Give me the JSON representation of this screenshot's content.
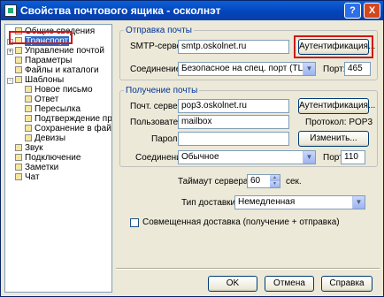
{
  "window": {
    "title": "Свойства почтового ящика - осколнэт",
    "help_glyph": "?",
    "close_glyph": "X"
  },
  "tree": [
    {
      "label": "Общие сведения",
      "level": 0
    },
    {
      "label": "Транспорт",
      "level": 0,
      "selected": true,
      "expander": "+"
    },
    {
      "label": "Управление почтой",
      "level": 0,
      "expander": "+"
    },
    {
      "label": "Параметры",
      "level": 0
    },
    {
      "label": "Файлы и каталоги",
      "level": 0
    },
    {
      "label": "Шаблоны",
      "level": 0,
      "expander": "-"
    },
    {
      "label": "Новое письмо",
      "level": 1
    },
    {
      "label": "Ответ",
      "level": 1
    },
    {
      "label": "Пересылка",
      "level": 1
    },
    {
      "label": "Подтверждение прочт",
      "level": 1
    },
    {
      "label": "Сохранение в файл",
      "level": 1
    },
    {
      "label": "Девизы",
      "level": 1
    },
    {
      "label": "Звук",
      "level": 0
    },
    {
      "label": "Подключение",
      "level": 0
    },
    {
      "label": "Заметки",
      "level": 0
    },
    {
      "label": "Чат",
      "level": 0
    }
  ],
  "outgoing": {
    "legend": "Отправка почты",
    "smtp_label": "SMTP-сервер:",
    "smtp_value": "smtp.oskolnet.ru",
    "auth_button": "Аутентификация...",
    "conn_label": "Соединение:",
    "conn_value": "Безопасное на спец. порт (TLS)",
    "port_label": "Порт:",
    "port_value": "465"
  },
  "incoming": {
    "legend": "Получение почты",
    "server_label": "Почт. сервер:",
    "server_value": "pop3.oskolnet.ru",
    "auth_button": "Аутентификация...",
    "user_label": "Пользователь:",
    "user_value": "mailbox",
    "protocol_text": "Протокол: POP3",
    "password_label": "Пароль:",
    "password_value": "",
    "change_button": "Изменить...",
    "conn_label": "Соединение:",
    "conn_value": "Обычное",
    "port_label": "Порт:",
    "port_value": "110"
  },
  "timeout": {
    "label": "Таймаут сервера:",
    "value": "60",
    "unit": "сек."
  },
  "delivery": {
    "label": "Тип доставки:",
    "value": "Немедленная"
  },
  "combined": {
    "label": "Совмещенная доставка (получение + отправка)",
    "checked": false
  },
  "footer": {
    "ok": "OK",
    "cancel": "Отмена",
    "help": "Справка"
  }
}
